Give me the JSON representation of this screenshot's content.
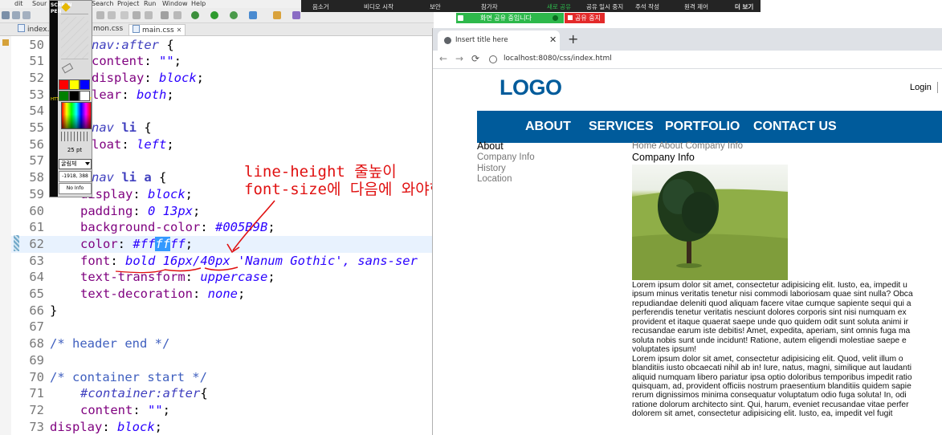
{
  "ide": {
    "menu": [
      "dit",
      "Sour",
      "Search",
      "Project",
      "Run",
      "Window",
      "Help"
    ],
    "tabs": [
      {
        "label": "index.h",
        "active": false
      },
      {
        "label": "mon.css",
        "active": false
      },
      {
        "label": "main.css",
        "active": true
      }
    ],
    "tab_close_glyph": "✕",
    "code_lines": [
      {
        "n": "50",
        "tokens": [
          [
            "sel",
            "nav:after "
          ],
          [
            "pun",
            "{"
          ]
        ]
      },
      {
        "n": "51",
        "tokens": [
          [
            "prop",
            "content"
          ],
          [
            "pun",
            ": "
          ],
          [
            "val",
            "\"\""
          ],
          [
            "pun",
            ";"
          ]
        ]
      },
      {
        "n": "52",
        "tokens": [
          [
            "prop",
            "display"
          ],
          [
            "pun",
            ": "
          ],
          [
            "val",
            "block"
          ],
          [
            "pun",
            ";"
          ]
        ]
      },
      {
        "n": "53",
        "tokens": [
          [
            "prop",
            "lear"
          ],
          [
            "pun",
            ": "
          ],
          [
            "val",
            "both"
          ],
          [
            "pun",
            ";"
          ]
        ]
      },
      {
        "n": "54",
        "tokens": []
      },
      {
        "n": "55",
        "tokens": [
          [
            "sel",
            "nav "
          ],
          [
            "selb",
            "li"
          ],
          [
            "pun",
            " {"
          ]
        ]
      },
      {
        "n": "56",
        "tokens": [
          [
            "prop",
            "loat"
          ],
          [
            "pun",
            ": "
          ],
          [
            "val",
            "left"
          ],
          [
            "pun",
            ";"
          ]
        ]
      },
      {
        "n": "57",
        "tokens": []
      },
      {
        "n": "58",
        "tokens": [
          [
            "sel",
            "nav "
          ],
          [
            "selb",
            "li a"
          ],
          [
            "pun",
            " {"
          ]
        ]
      },
      {
        "n": "59",
        "tokens": [
          [
            "prop",
            "display"
          ],
          [
            "pun",
            ": "
          ],
          [
            "val",
            "block"
          ],
          [
            "pun",
            ";"
          ]
        ]
      },
      {
        "n": "60",
        "tokens": [
          [
            "prop",
            "padding"
          ],
          [
            "pun",
            ": "
          ],
          [
            "val",
            "0 13px"
          ],
          [
            "pun",
            ";"
          ]
        ]
      },
      {
        "n": "61",
        "tokens": [
          [
            "prop",
            "background-color"
          ],
          [
            "pun",
            ": "
          ],
          [
            "val",
            "#005B9B"
          ],
          [
            "pun",
            ";"
          ]
        ]
      },
      {
        "n": "62",
        "tokens": [
          [
            "prop",
            "color"
          ],
          [
            "pun",
            ": "
          ],
          [
            "val",
            "#ff"
          ],
          [
            "hl",
            "ff"
          ],
          [
            "val",
            "ff"
          ],
          [
            "pun",
            ";"
          ]
        ],
        "current": true
      },
      {
        "n": "63",
        "tokens": [
          [
            "prop",
            "font"
          ],
          [
            "pun",
            ": "
          ],
          [
            "val",
            "bold 16px/40px 'Nanum Gothic', sans-ser"
          ]
        ]
      },
      {
        "n": "64",
        "tokens": [
          [
            "prop",
            "text-transform"
          ],
          [
            "pun",
            ": "
          ],
          [
            "val",
            "uppercase"
          ],
          [
            "pun",
            ";"
          ]
        ]
      },
      {
        "n": "65",
        "tokens": [
          [
            "prop",
            "text-decoration"
          ],
          [
            "pun",
            ": "
          ],
          [
            "val",
            "none"
          ],
          [
            "pun",
            ";"
          ]
        ]
      },
      {
        "n": "66",
        "tokens": [
          [
            "pun",
            "}"
          ]
        ]
      },
      {
        "n": "67",
        "tokens": []
      },
      {
        "n": "68",
        "tokens": [
          [
            "cmt",
            "/* header end */"
          ]
        ]
      },
      {
        "n": "69",
        "tokens": []
      },
      {
        "n": "70",
        "tokens": [
          [
            "cmt",
            "/* container start */"
          ]
        ]
      },
      {
        "n": "71",
        "tokens": [
          [
            "sel",
            "#container:after"
          ],
          [
            "pun",
            "{"
          ]
        ]
      },
      {
        "n": "72",
        "tokens": [
          [
            "prop",
            "content"
          ],
          [
            "pun",
            ": "
          ],
          [
            "val",
            "\"\""
          ],
          [
            "pun",
            ";"
          ]
        ]
      },
      {
        "n": "73",
        "tokens": [
          [
            "prop",
            "display"
          ],
          [
            "pun",
            ": "
          ],
          [
            "val",
            "block"
          ],
          [
            "pun",
            ";"
          ]
        ]
      }
    ]
  },
  "annotation": {
    "line1": "line-height 줄높이",
    "line2": "font-size에 다음에 와야한다",
    "color": "#e01010"
  },
  "screen_pen": {
    "strip_text": "SCREEN PEN",
    "strip_url": "HTTP://DOLBA.NET",
    "swatches": [
      "#ff0000",
      "#ffff00",
      "#0000ff",
      "#008000",
      "#000000",
      "#ffffff"
    ],
    "size_label": "25 pt",
    "font_label": "굴림체",
    "coord_label": "-1918, 388",
    "info_label": "No Info"
  },
  "share_bar": {
    "items": [
      "음소거",
      "비디오 시작",
      "보안",
      "참가자",
      "새로 공유",
      "공유 일시 중지",
      "주석 작성",
      "원격 제어",
      "더 보기"
    ],
    "highlight_color": "#2db84b",
    "status": "화면 공유 중입니다",
    "stop": "공유 중지"
  },
  "browser": {
    "tab_title": "Insert title here",
    "new_tab_glyph": "+",
    "url": "localhost:8080/css/index.html",
    "page": {
      "logo": "LOGO",
      "login": "Login",
      "nav": [
        "ABOUT",
        "SERVICES",
        "PORTFOLIO",
        "CONTACT US"
      ],
      "nav_color": "#005b9b",
      "side_title": "About",
      "side_items": [
        "Company Info",
        "History",
        "Location"
      ],
      "breadcrumb": "Home About Company Info",
      "content_title": "Company Info",
      "lorem": [
        "Lorem ipsum dolor sit amet, consectetur adipisicing elit. Iusto, ea, impedit u",
        "ipsum minus veritatis tenetur nisi commodi laboriosam quae sint nulla? Obca",
        "repudiandae deleniti quod aliquam facere vitae cumque sapiente sequi qui a",
        "perferendis tenetur veritatis nesciunt dolores corporis sint nisi numquam ex",
        "provident et itaque quaerat saepe unde quo quidem odit sunt soluta animi ir",
        "recusandae earum iste debitis! Amet, expedita, aperiam, sint omnis fuga ma",
        "soluta nobis sunt unde incidunt! Ratione, autem eligendi molestiae saepe e",
        "voluptates ipsum!",
        "Lorem ipsum dolor sit amet, consectetur adipisicing elit. Quod, velit illum o",
        "blanditiis iusto obcaecati nihil ab in! Iure, natus, magni, similique aut laudanti",
        "aliquid numquam libero pariatur ipsa optio doloribus temporibus impedit ratio",
        "quisquam, ad, provident officiis nostrum praesentium blanditiis quidem sapie",
        "rerum dignissimos minima consequatur voluptatum odio fuga soluta! In, odi",
        "ratione dolorum architecto sint. Qui, harum, eveniet recusandae vitae perfer",
        "dolorem sit amet, consectetur adipisicing elit. Iusto, ea, impedit vel fugit"
      ]
    }
  }
}
